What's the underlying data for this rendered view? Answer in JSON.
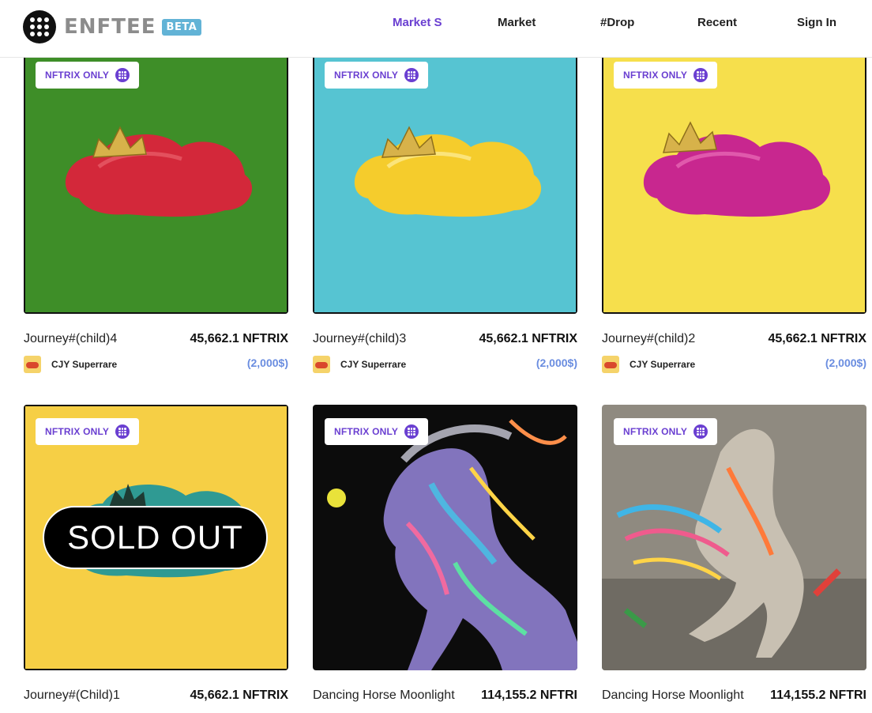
{
  "header": {
    "logo_text": "ENFTEE",
    "beta_label": "BETA",
    "nav": [
      {
        "label": "Market S",
        "active": true
      },
      {
        "label": "Market",
        "active": false
      },
      {
        "label": "#Drop",
        "active": false
      },
      {
        "label": "Recent",
        "active": false
      },
      {
        "label": "Sign In",
        "active": false
      }
    ]
  },
  "colors": {
    "accent": "#6a3fd1",
    "usd": "#6a8de0",
    "beta": "#62b3d6"
  },
  "cards": [
    {
      "badge": "NFTRIX ONLY",
      "title": "Journey#(child)4",
      "price": "45,662.1 NFTRIX",
      "creator": "CJY Superrare",
      "usd": "(2,000$)",
      "bg": "#3e8e28",
      "art": "red-cloud-crown",
      "sold_out": false
    },
    {
      "badge": "NFTRIX ONLY",
      "title": "Journey#(child)3",
      "price": "45,662.1 NFTRIX",
      "creator": "CJY Superrare",
      "usd": "(2,000$)",
      "bg": "#56c4d2",
      "art": "yellow-cloud-crown",
      "sold_out": false
    },
    {
      "badge": "NFTRIX ONLY",
      "title": "Journey#(child)2",
      "price": "45,662.1 NFTRIX",
      "creator": "CJY Superrare",
      "usd": "(2,000$)",
      "bg": "#f6df4c",
      "art": "magenta-cloud-crown",
      "sold_out": false
    },
    {
      "badge": "NFTRIX ONLY",
      "title": "Journey#(Child)1",
      "price": "45,662.1 NFTRIX",
      "bg": "#f6cf45",
      "art": "teal-cloud-crown",
      "sold_out": true,
      "sold_out_label": "SOLD OUT"
    },
    {
      "badge": "NFTRIX ONLY",
      "title": "Dancing Horse Moonlight",
      "price": "114,155.2 NFTRI",
      "bg": "#0c0c0c",
      "art": "horse-painting-dark",
      "sold_out": false
    },
    {
      "badge": "NFTRIX ONLY",
      "title": "Dancing Horse Moonlight",
      "price": "114,155.2 NFTRI",
      "bg": "#8f8a80",
      "art": "horse-painting-grey",
      "sold_out": false
    }
  ]
}
